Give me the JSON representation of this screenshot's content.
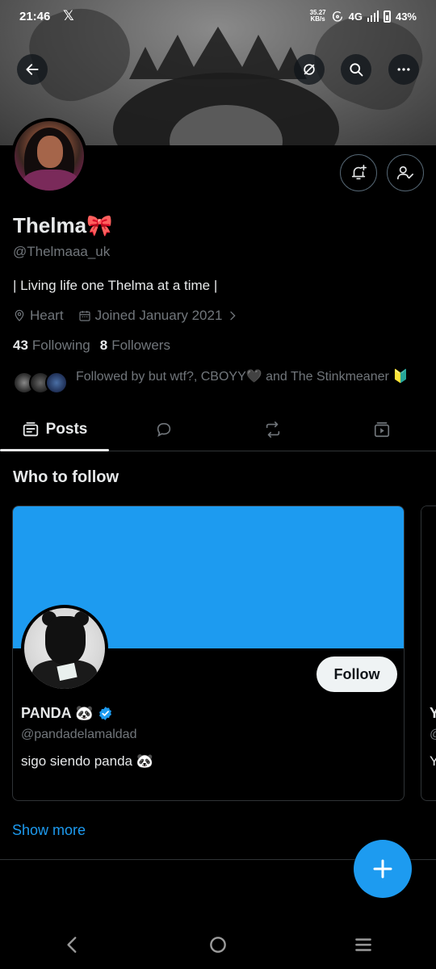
{
  "status_bar": {
    "time": "21:46",
    "x_logo": "𝕏",
    "speed_value": "35.27",
    "speed_unit": "KB/s",
    "network": "4G",
    "battery": "43%"
  },
  "header": {
    "back_icon": "arrow-left-icon",
    "grok_icon": "grok-icon",
    "search_icon": "search-icon",
    "more_icon": "more-icon"
  },
  "profile": {
    "name": "Thelma🎀",
    "handle": "@Thelmaaa_uk",
    "bio": "| Living life one Thelma at a time |",
    "location": "Heart",
    "joined": "Joined January 2021",
    "following_count": "43",
    "following_label": "Following",
    "followers_count": "8",
    "followers_label": "Followers",
    "followed_by": "Followed by but wtf?, CBOYY🖤 and The Stinkmeaner 🔰"
  },
  "tabs": [
    {
      "label": "Posts",
      "icon": "posts-icon"
    },
    {
      "label": "",
      "icon": "reply-icon"
    },
    {
      "label": "",
      "icon": "repost-icon"
    },
    {
      "label": "",
      "icon": "media-icon"
    }
  ],
  "who_to_follow": {
    "title": "Who to follow",
    "cards": [
      {
        "name": "PANDA 🐼",
        "handle": "@pandadelamaldad",
        "bio": "sigo siendo panda 🐼",
        "follow_label": "Follow",
        "banner_color": "#1d9bf0"
      },
      {
        "name": "Y",
        "handle": "@",
        "bio": "Y"
      }
    ],
    "show_more": "Show more"
  },
  "colors": {
    "accent": "#1d9bf0",
    "text_primary": "#e7e9ea",
    "text_secondary": "#71767b",
    "border": "#2f3336",
    "background": "#000000"
  }
}
